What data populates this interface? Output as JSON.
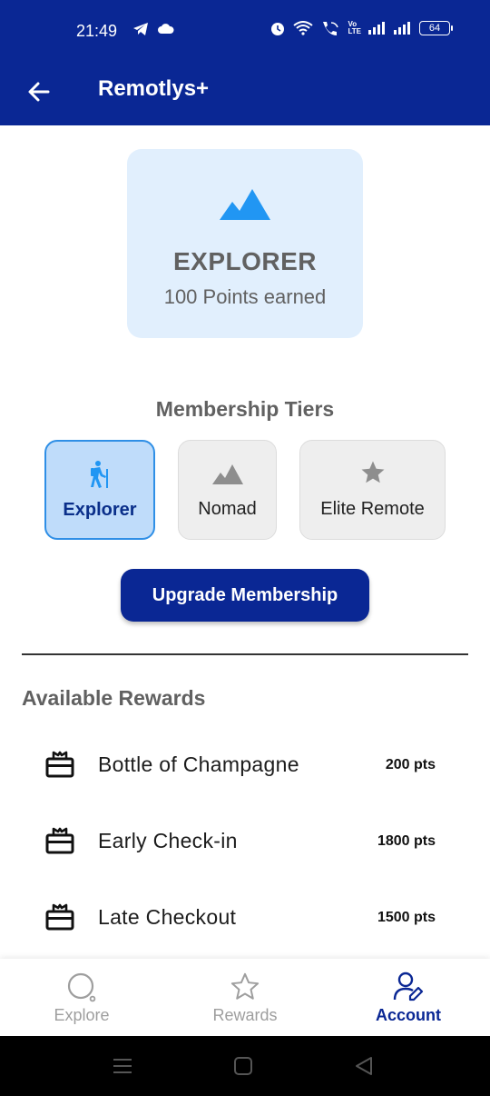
{
  "status_bar": {
    "time": "21:49",
    "battery": "64",
    "volte": "Vo LTE"
  },
  "app_bar": {
    "title": "Remotlys+",
    "back_icon": "arrow-left-icon"
  },
  "current_tier": {
    "icon": "mountain-icon",
    "name": "EXPLORER",
    "points": "100 Points earned"
  },
  "membership": {
    "title": "Membership Tiers",
    "tiers": [
      {
        "label": "Explorer",
        "icon": "hiker-icon",
        "selected": true
      },
      {
        "label": "Nomad",
        "icon": "mountain-icon",
        "selected": false
      },
      {
        "label": "Elite Remote",
        "icon": "star-icon",
        "selected": false
      }
    ],
    "upgrade_label": "Upgrade Membership"
  },
  "rewards": {
    "title": "Available Rewards",
    "items": [
      {
        "name": "Bottle of Champagne",
        "points": "200 pts",
        "icon": "gift-card-icon"
      },
      {
        "name": "Early Check-in",
        "points": "1800 pts",
        "icon": "gift-card-icon"
      },
      {
        "name": "Late Checkout",
        "points": "1500 pts",
        "icon": "gift-card-icon"
      }
    ]
  },
  "bottom_nav": {
    "items": [
      {
        "label": "Explore",
        "icon": "explore-search-icon",
        "active": false
      },
      {
        "label": "Rewards",
        "icon": "star-outline-icon",
        "active": false
      },
      {
        "label": "Account",
        "icon": "account-edit-icon",
        "active": true
      }
    ]
  },
  "colors": {
    "primary": "#0a2794",
    "card_bg": "#e1effd",
    "selected_tier_bg": "#bfdcfa",
    "selected_tier_border": "#2f8fe6",
    "accent_icon": "#2196f3"
  }
}
